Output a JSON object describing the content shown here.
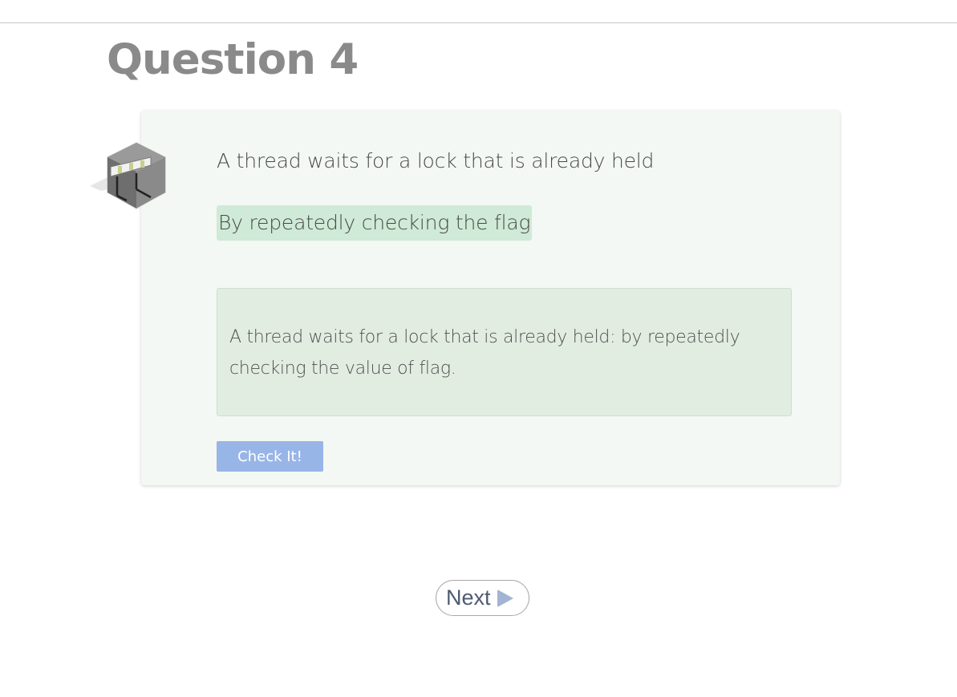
{
  "page": {
    "title": "Question 4"
  },
  "question": {
    "prompt": "A thread waits for a lock that is already held",
    "selected_answer": "By repeatedly checking the flag",
    "feedback": "A thread waits for a lock that is already held: by repeatedly checking the value of flag.",
    "icon": "isometric-room-icon"
  },
  "actions": {
    "check_label": "Check It!",
    "next_label": "Next",
    "next_icon": "play-triangle-icon"
  },
  "colors": {
    "title": "#8a8a8a",
    "card_background": "#f3f8f4",
    "selected_answer_highlight": "#cfead6",
    "feedback_background": "#e2ede2",
    "check_button": "#98b5e8",
    "next_arrow": "#a3b3d3"
  }
}
